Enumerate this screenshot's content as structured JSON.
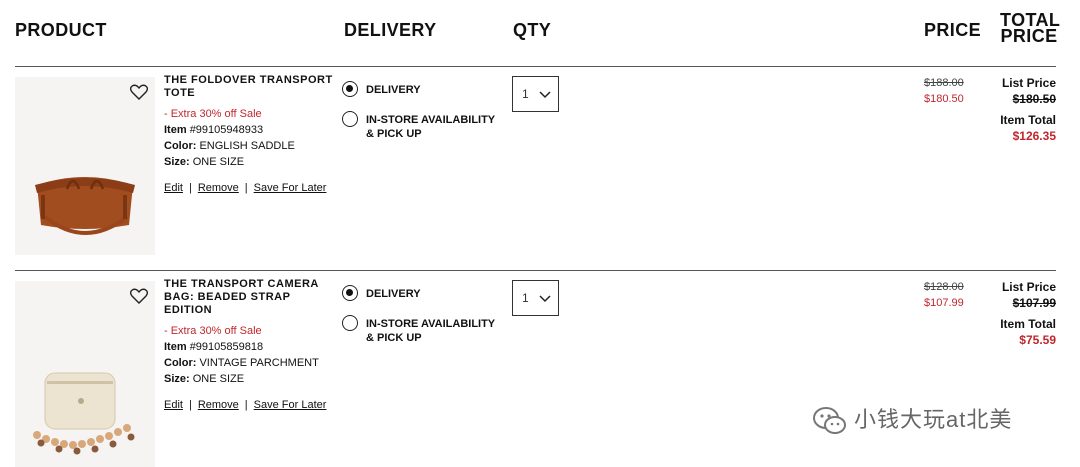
{
  "header": {
    "product": "PRODUCT",
    "delivery": "DELIVERY",
    "qty": "QTY",
    "price": "PRICE",
    "total_line1": "TOTAL",
    "total_line2": "PRICE"
  },
  "items": [
    {
      "name": "THE FOLDOVER TRANSPORT TOTE",
      "promo": "- Extra 30% off Sale",
      "item_label": "Item",
      "item_no": "#99105948933",
      "color_label": "Color:",
      "color": "ENGLISH SADDLE",
      "size_label": "Size:",
      "size": "ONE SIZE",
      "edit": "Edit",
      "remove": "Remove",
      "save": "Save For Later",
      "delivery_opt": "DELIVERY",
      "instore_opt": "IN-STORE AVAILABILITY & PICK UP",
      "delivery_selected": true,
      "qty": "1",
      "price_was": "$188.00",
      "price_now": "$180.50",
      "list_price_label": "List Price",
      "list_price": "$180.50",
      "item_total_label": "Item Total",
      "item_total": "$126.35",
      "image_color": "#9c4a20"
    },
    {
      "name": "THE TRANSPORT CAMERA BAG: BEADED STRAP EDITION",
      "promo": "- Extra 30% off Sale",
      "item_label": "Item",
      "item_no": "#99105859818",
      "color_label": "Color:",
      "color": "VINTAGE PARCHMENT",
      "size_label": "Size:",
      "size": "ONE SIZE",
      "edit": "Edit",
      "remove": "Remove",
      "save": "Save For Later",
      "delivery_opt": "DELIVERY",
      "instore_opt": "IN-STORE AVAILABILITY & PICK UP",
      "delivery_selected": true,
      "qty": "1",
      "price_was": "$128.00",
      "price_now": "$107.99",
      "list_price_label": "List Price",
      "list_price": "$107.99",
      "item_total_label": "Item Total",
      "item_total": "$75.59",
      "image_color": "#e8e0cc"
    }
  ],
  "watermark": "小钱大玩at北美",
  "colors": {
    "sale_red": "#c0272d",
    "text": "#111111",
    "rule": "#555555"
  },
  "icons": [
    "heart-icon",
    "chevron-down-icon",
    "radio-icon",
    "wechat-icon"
  ]
}
